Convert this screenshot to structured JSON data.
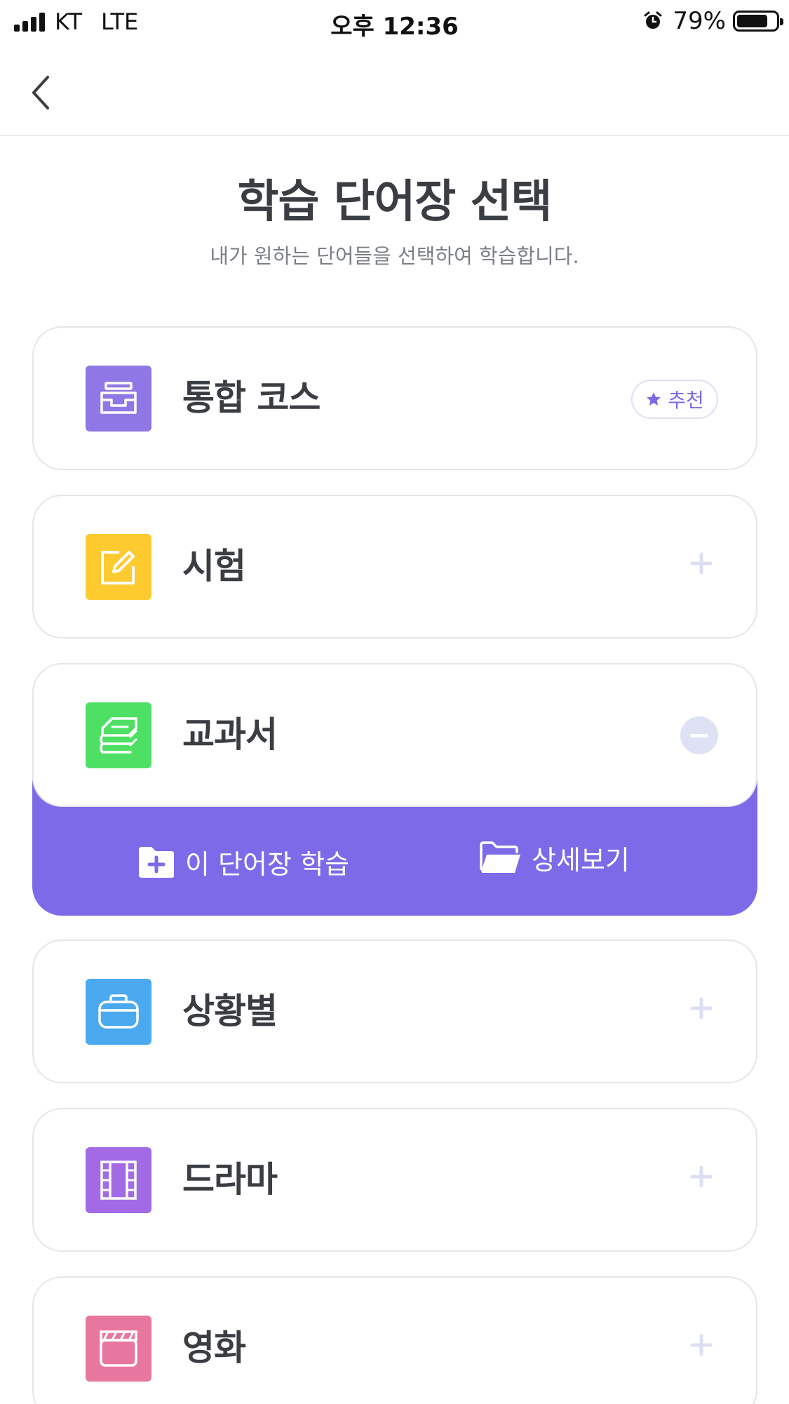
{
  "status_bar": {
    "carrier": "KT",
    "network": "LTE",
    "time": "오후 12:36",
    "battery_percent": "79%",
    "battery_level": 0.79
  },
  "header": {
    "back_icon": "chevron-left-icon",
    "title": "학습 단어장 선택",
    "subtitle": "내가 원하는 단어들을 선택하여 학습합니다."
  },
  "courses": [
    {
      "label": "통합 코스",
      "icon": "inbox-tray-icon",
      "color": "#8f78e6",
      "badge": "추천",
      "state": "badge"
    },
    {
      "label": "시험",
      "icon": "edit-note-icon",
      "color": "#fdca2f",
      "state": "collapsed"
    },
    {
      "label": "교과서",
      "icon": "book-stack-icon",
      "color": "#4ee065",
      "state": "expanded"
    },
    {
      "label": "상황별",
      "icon": "briefcase-icon",
      "color": "#4ba9ef",
      "state": "collapsed"
    },
    {
      "label": "드라마",
      "icon": "film-strip-icon",
      "color": "#a36ae6",
      "state": "collapsed"
    },
    {
      "label": "영화",
      "icon": "clapperboard-icon",
      "color": "#e8779f",
      "state": "collapsed"
    }
  ],
  "expanded_actions": {
    "study_label": "이 단어장 학습",
    "details_label": "상세보기",
    "panel_color": "#7c6ae9"
  }
}
